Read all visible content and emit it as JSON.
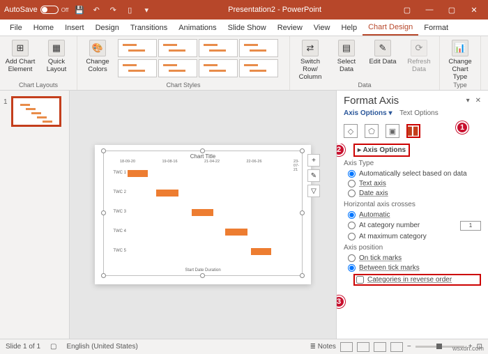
{
  "titlebar": {
    "autosave_label": "AutoSave",
    "autosave_state": "Off",
    "doc_title": "Presentation2 - PowerPoint"
  },
  "ribbon_tabs": [
    "File",
    "Home",
    "Insert",
    "Design",
    "Transitions",
    "Animations",
    "Slide Show",
    "Review",
    "View",
    "Help",
    "Chart Design",
    "Format"
  ],
  "ribbon_active_tab": "Chart Design",
  "ribbon_groups": {
    "chart_layouts": {
      "label": "Chart Layouts",
      "add_element": "Add Chart Element",
      "quick_layout": "Quick Layout"
    },
    "chart_styles": {
      "label": "Chart Styles",
      "change_colors": "Change Colors"
    },
    "data": {
      "label": "Data",
      "switch": "Switch Row/ Column",
      "select": "Select Data",
      "edit": "Edit Data",
      "refresh": "Refresh Data"
    },
    "type": {
      "label": "Type",
      "change_type": "Change Chart Type"
    }
  },
  "slide_thumb": {
    "number": "1"
  },
  "chart": {
    "title": "Chart Title",
    "categories": [
      "TWC 1",
      "TWC 2",
      "TWC 3",
      "TWC 4",
      "TWC 5"
    ],
    "x_ticks": [
      "18-09-20",
      "19-08-16",
      "21-04-22",
      "22-06-26",
      "23-07-21"
    ],
    "legend": "Start Date   Duration"
  },
  "chart_data": {
    "type": "bar",
    "orientation": "horizontal",
    "stacked": true,
    "categories": [
      "TWC 1",
      "TWC 2",
      "TWC 3",
      "TWC 4",
      "TWC 5"
    ],
    "series": [
      {
        "name": "Start Date",
        "values": [
          0,
          90,
          200,
          300,
          380
        ],
        "color": "transparent"
      },
      {
        "name": "Duration",
        "values": [
          60,
          70,
          70,
          65,
          60
        ],
        "color": "#ed7d31"
      }
    ],
    "title": "Chart Title",
    "x_ticks": [
      "18-09-20",
      "19-08-16",
      "21-04-22",
      "22-06-26",
      "23-07-21"
    ],
    "xlim": [
      0,
      520
    ]
  },
  "format_pane": {
    "title": "Format Axis",
    "tab_axis": "Axis Options",
    "tab_text": "Text Options",
    "section_axis_options": "Axis Options",
    "axis_type_label": "Axis Type",
    "opt_auto": "Automatically select based on data",
    "opt_text_axis": "Text axis",
    "opt_date_axis": "Date axis",
    "hcross_label": "Horizontal axis crosses",
    "opt_automatic": "Automatic",
    "opt_at_category": "At category number",
    "at_category_value": "1",
    "opt_at_max": "At maximum category",
    "axis_position_label": "Axis position",
    "opt_on_tick": "On tick marks",
    "opt_between_tick": "Between tick marks",
    "opt_reverse": "Categories in reverse order"
  },
  "callouts": {
    "c1": "1",
    "c2": "2",
    "c3": "3"
  },
  "status": {
    "slide_info": "Slide 1 of 1",
    "language": "English (United States)",
    "notes": "Notes",
    "zoom_minus": "−",
    "zoom_plus": "+"
  },
  "watermark": "wsxdn.com"
}
